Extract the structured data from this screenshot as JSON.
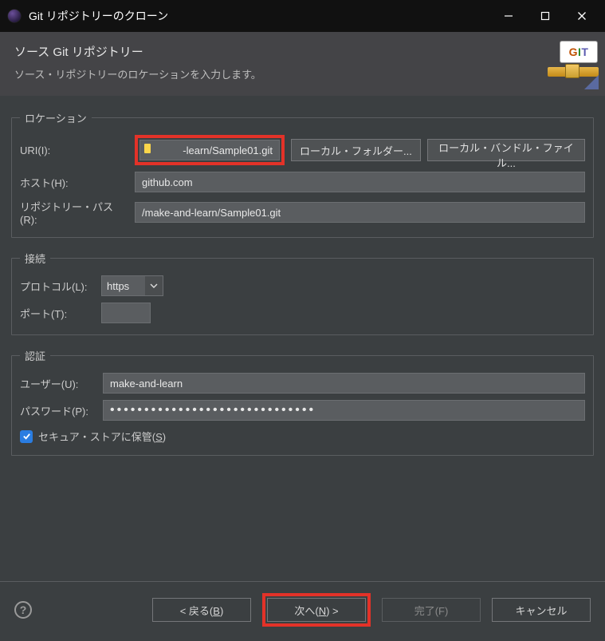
{
  "window": {
    "title": "Git リポジトリーのクローン"
  },
  "banner": {
    "title": "ソース Git リポジトリー",
    "subtitle": "ソース・リポジトリーのロケーションを入力します。",
    "badge": "GIT"
  },
  "location": {
    "legend": "ロケーション",
    "uri_label": "URI(I):",
    "uri_value": "-learn/Sample01.git",
    "local_folder_btn": "ローカル・フォルダー...",
    "local_bundle_btn": "ローカル・バンドル・ファイル...",
    "host_label": "ホスト(H):",
    "host_value": "github.com",
    "repo_path_label": "リポジトリー・パス(R):",
    "repo_path_value": "/make-and-learn/Sample01.git"
  },
  "connection": {
    "legend": "接続",
    "protocol_label": "プロトコル(L):",
    "protocol_value": "https",
    "port_label": "ポート(T):",
    "port_value": ""
  },
  "auth": {
    "legend": "認証",
    "user_label": "ユーザー(U):",
    "user_value": "make-and-learn",
    "password_label": "パスワード(P):",
    "password_value": "●●●●●●●●●●●●●●●●●●●●●●●●●●●●●●",
    "secure_store_label": "セキュア・ストアに保管(",
    "secure_store_mnemonic": "S",
    "secure_store_label_end": ")",
    "secure_store_checked": true
  },
  "footer": {
    "back": "< 戻る(",
    "back_m": "B",
    "back_end": ")",
    "next": "次へ(",
    "next_m": "N",
    "next_end": ") >",
    "finish": "完了(F)",
    "cancel": "キャンセル"
  }
}
